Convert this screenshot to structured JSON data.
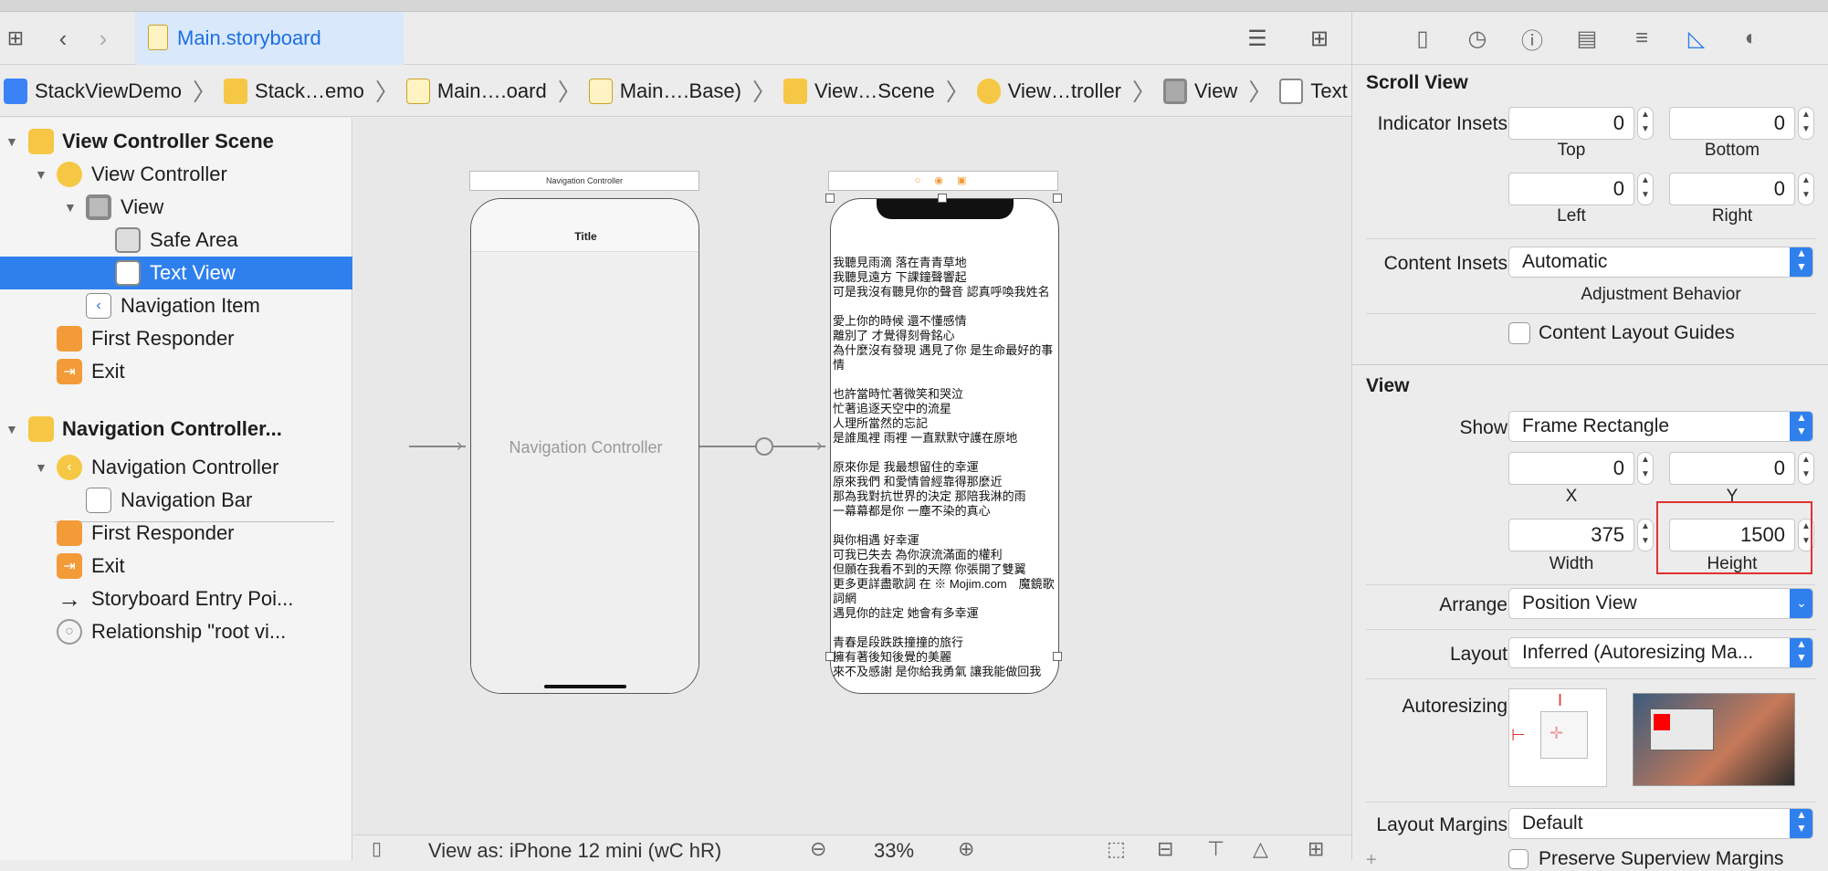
{
  "tabbar": {
    "active_tab": "Main.storyboard"
  },
  "breadcrumb": [
    "StackViewDemo",
    "Stack…emo",
    "Main….oard",
    "Main….Base)",
    "View…Scene",
    "View…troller",
    "View",
    "Text View"
  ],
  "outline": {
    "items": [
      {
        "label": "View Controller Scene",
        "bold": true
      },
      {
        "label": "View Controller"
      },
      {
        "label": "View"
      },
      {
        "label": "Safe Area"
      },
      {
        "label": "Text View"
      },
      {
        "label": "Navigation Item"
      },
      {
        "label": "First Responder"
      },
      {
        "label": "Exit"
      },
      {
        "label": "Navigation Controller...",
        "bold": true
      },
      {
        "label": "Navigation Controller"
      },
      {
        "label": "Navigation Bar"
      },
      {
        "label": "First Responder"
      },
      {
        "label": "Exit"
      },
      {
        "label": "Storyboard Entry Poi..."
      },
      {
        "label": "Relationship \"root vi..."
      }
    ]
  },
  "canvas": {
    "nav_scene_header": "Navigation Controller",
    "nav_title": "Title",
    "nav_placeholder": "Navigation Controller",
    "lyrics": "我聽見雨滴 落在青青草地\n我聽見遠方 下課鐘聲響起\n可是我沒有聽見你的聲音 認真呼喚我姓名\n\n愛上你的時候 還不懂感情\n離別了 才覺得刻骨銘心\n為什麼沒有發現 遇見了你 是生命最好的事情\n\n也許當時忙著微笑和哭泣\n忙著追逐天空中的流星\n人理所當然的忘記\n是誰風裡 雨裡 一直默默守護在原地\n\n原來你是 我最想留住的幸運\n原來我們 和愛情曾經靠得那麼近\n那為我對抗世界的決定 那陪我淋的雨\n一幕幕都是你 一塵不染的真心\n\n與你相遇 好幸運\n可我已失去 為你淚流滿面的權利\n但願在我看不到的天際 你張開了雙翼\n更多更詳盡歌詞 在 ※ Mojim.com　魔鏡歌詞網\n遇見你的註定 她會有多幸運\n\n青春是段跌跌撞撞的旅行\n擁有著後知後覺的美麗\n來不及感謝 是你給我勇氣 讓我能做回我",
    "bottom_text": "View as: iPhone 12 mini (wC hR)",
    "zoom": "33%"
  },
  "inspector": {
    "scroll_view": {
      "title": "Scroll View",
      "indicator_insets_label": "Indicator Insets",
      "top": "0",
      "bottom": "0",
      "left": "0",
      "right": "0",
      "top_label": "Top",
      "bottom_label": "Bottom",
      "left_label": "Left",
      "right_label": "Right",
      "content_insets_label": "Content Insets",
      "content_insets_value": "Automatic",
      "adjustment_label": "Adjustment Behavior",
      "content_layout_guides": "Content Layout Guides"
    },
    "view": {
      "title": "View",
      "show_label": "Show",
      "show_value": "Frame Rectangle",
      "x": "0",
      "y": "0",
      "x_label": "X",
      "y_label": "Y",
      "width": "375",
      "height": "1500",
      "width_label": "Width",
      "height_label": "Height",
      "arrange_label": "Arrange",
      "arrange_value": "Position View",
      "layout_label": "Layout",
      "layout_value": "Inferred (Autoresizing Ma...",
      "autoresizing_label": "Autoresizing",
      "layout_margins_label": "Layout Margins",
      "layout_margins_value": "Default",
      "preserve_label": "Preserve Superview Margins"
    }
  }
}
